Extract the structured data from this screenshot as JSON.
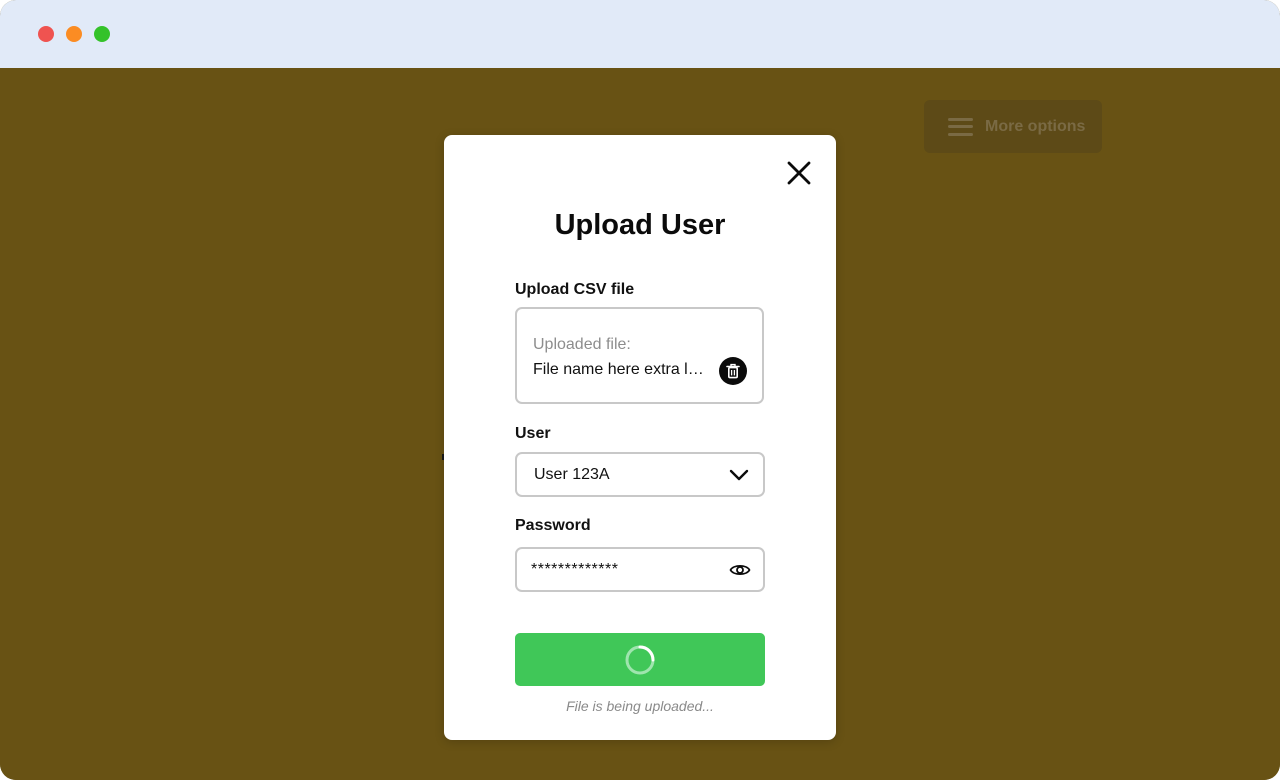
{
  "window": {
    "controls": [
      "close-dot",
      "minimize-dot",
      "maximize-dot"
    ]
  },
  "background": {
    "more_options_label": "More options",
    "more_options_icon": "menu-icon"
  },
  "modal": {
    "title": "Upload User",
    "close_icon": "close-icon",
    "upload": {
      "label": "Upload CSV file",
      "caption": "Uploaded file:",
      "filename": "File name here extra long name.csv",
      "delete_icon": "trash-icon"
    },
    "user": {
      "label": "User",
      "selected": "User 123A",
      "icon": "chevron-down-icon"
    },
    "password": {
      "label": "Password",
      "value": "*************",
      "icon": "eye-icon"
    },
    "submit": {
      "state": "loading",
      "icon": "spinner-icon",
      "color": "#40c758"
    },
    "status": "File is being uploaded..."
  },
  "colors": {
    "overlay_background": "#685214",
    "titlebar": "#e1eaf8",
    "accent_green": "#40c758"
  }
}
